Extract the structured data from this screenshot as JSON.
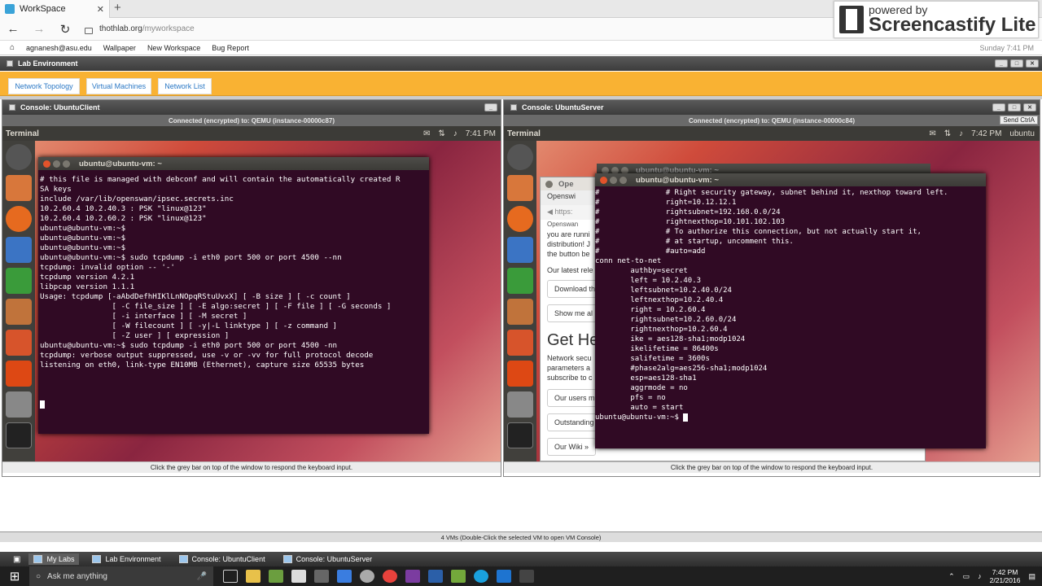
{
  "browser": {
    "tab_title": "WorkSpace",
    "url_host": "thothlab.org",
    "url_path": "/myworkspace"
  },
  "screencastify": {
    "line1": "powered by",
    "line2": "Screencastify Lite"
  },
  "labnav": {
    "user": "agnanesh@asu.edu",
    "items": [
      "Wallpaper",
      "New Workspace",
      "Bug Report"
    ],
    "datetime": "Sunday 7:41 PM"
  },
  "labwin": {
    "title": "Lab Environment"
  },
  "tabs": [
    "Network Topology",
    "Virtual Machines",
    "Network List"
  ],
  "client": {
    "title": "Console: UbuntuClient",
    "connected": "Connected (encrypted) to: QEMU (instance-00000c87)",
    "panel_app": "Terminal",
    "panel_time": "7:41 PM",
    "term_title": "ubuntu@ubuntu-vm: ~",
    "lines": [
      "# this file is managed with debconf and will contain the automatically created R",
      "SA keys",
      "include /var/lib/openswan/ipsec.secrets.inc",
      "10.2.60.4 10.2.40.3 : PSK \"linux@123\"",
      "10.2.60.4 10.2.60.2 : PSK \"linux@123\"",
      "ubuntu@ubuntu-vm:~$",
      "ubuntu@ubuntu-vm:~$",
      "ubuntu@ubuntu-vm:~$",
      "ubuntu@ubuntu-vm:~$ sudo tcpdump -i eth0 port 500 or port 4500 --nn",
      "tcpdump: invalid option -- '-'",
      "tcpdump version 4.2.1",
      "libpcap version 1.1.1",
      "Usage: tcpdump [-aAbdDefhHIKlLnNOpqRStuUvxX] [ -B size ] [ -c count ]",
      "                [ -C file_size ] [ -E algo:secret ] [ -F file ] [ -G seconds ]",
      "                [ -i interface ] [ -M secret ]",
      "                [ -W filecount ] [ -y|-L linktype ] [ -z command ]",
      "                [ -Z user ] [ expression ]",
      "ubuntu@ubuntu-vm:~$ sudo tcpdump -i eth0 port 500 or port 4500 -nn",
      "tcpdump: verbose output suppressed, use -v or -vv for full protocol decode",
      "listening on eth0, link-type EN10MB (Ethernet), capture size 65535 bytes",
      "",
      "",
      ""
    ],
    "hint": "Click the grey bar on top of the window to respond the keyboard input."
  },
  "server": {
    "title": "Console: UbuntuServer",
    "connected": "Connected (encrypted) to: QEMU (instance-00000c84)",
    "send": "Send CtrlA",
    "panel_app": "Terminal",
    "panel_time": "7:42 PM",
    "panel_user": "ubuntu",
    "term_title": "ubuntu@ubuntu-vm: ~",
    "back_title": "ubuntu@ubuntu-vm: ~",
    "browser_frag": {
      "title": "Ope",
      "tab": "Openswi",
      "url": "https:",
      "p1": "you are runni",
      "p2": "distribution! J",
      "p3": "the button be",
      "latest": "Our latest rele",
      "download": "Download th",
      "show": "Show me al",
      "get": "Get He",
      "net1": "Network secu",
      "net2": "parameters a",
      "net3": "subscribe to c",
      "users": "Our users m",
      "outstanding": "Outstanding issues »",
      "wiki": "Our Wiki »",
      "top": "Openswan"
    },
    "lines": [
      "#               # Right security gateway, subnet behind it, nexthop toward left.",
      "#               right=10.12.12.1",
      "#               rightsubnet=192.168.0.0/24",
      "#               rightnexthop=10.101.102.103",
      "#               # To authorize this connection, but not actually start it,",
      "#               # at startup, uncomment this.",
      "#               #auto=add",
      "conn net-to-net",
      "        authby=secret",
      "        left = 10.2.40.3",
      "        leftsubnet=10.2.40.0/24",
      "        leftnexthop=10.2.40.4",
      "        right = 10.2.60.4",
      "        rightsubnet=10.2.60.0/24",
      "        rightnexthop=10.2.60.4",
      "        ike = aes128-sha1;modp1024",
      "        ikelifetime = 86400s",
      "        salifetime = 3600s",
      "        #phase2alg=aes256-sha1;modp1024",
      "        esp=aes128-sha1",
      "        aggrmode = no",
      "        pfs = no",
      "        auto = start",
      "ubuntu@ubuntu-vm:~$ "
    ],
    "hint": "Click the grey bar on top of the window to respond the keyboard input."
  },
  "status": "4 VMs (Double-Click the selected VM to open VM Console)",
  "labtasks": [
    "My Labs",
    "Lab Environment",
    "Console: UbuntuClient",
    "Console: UbuntuServer"
  ],
  "taskbar": {
    "search": "Ask me anything",
    "time": "7:42 PM",
    "date": "2/21/2016"
  },
  "colors": {
    "orange": "#f9b233",
    "term_bg": "#300a24",
    "link": "#2b78c5"
  }
}
